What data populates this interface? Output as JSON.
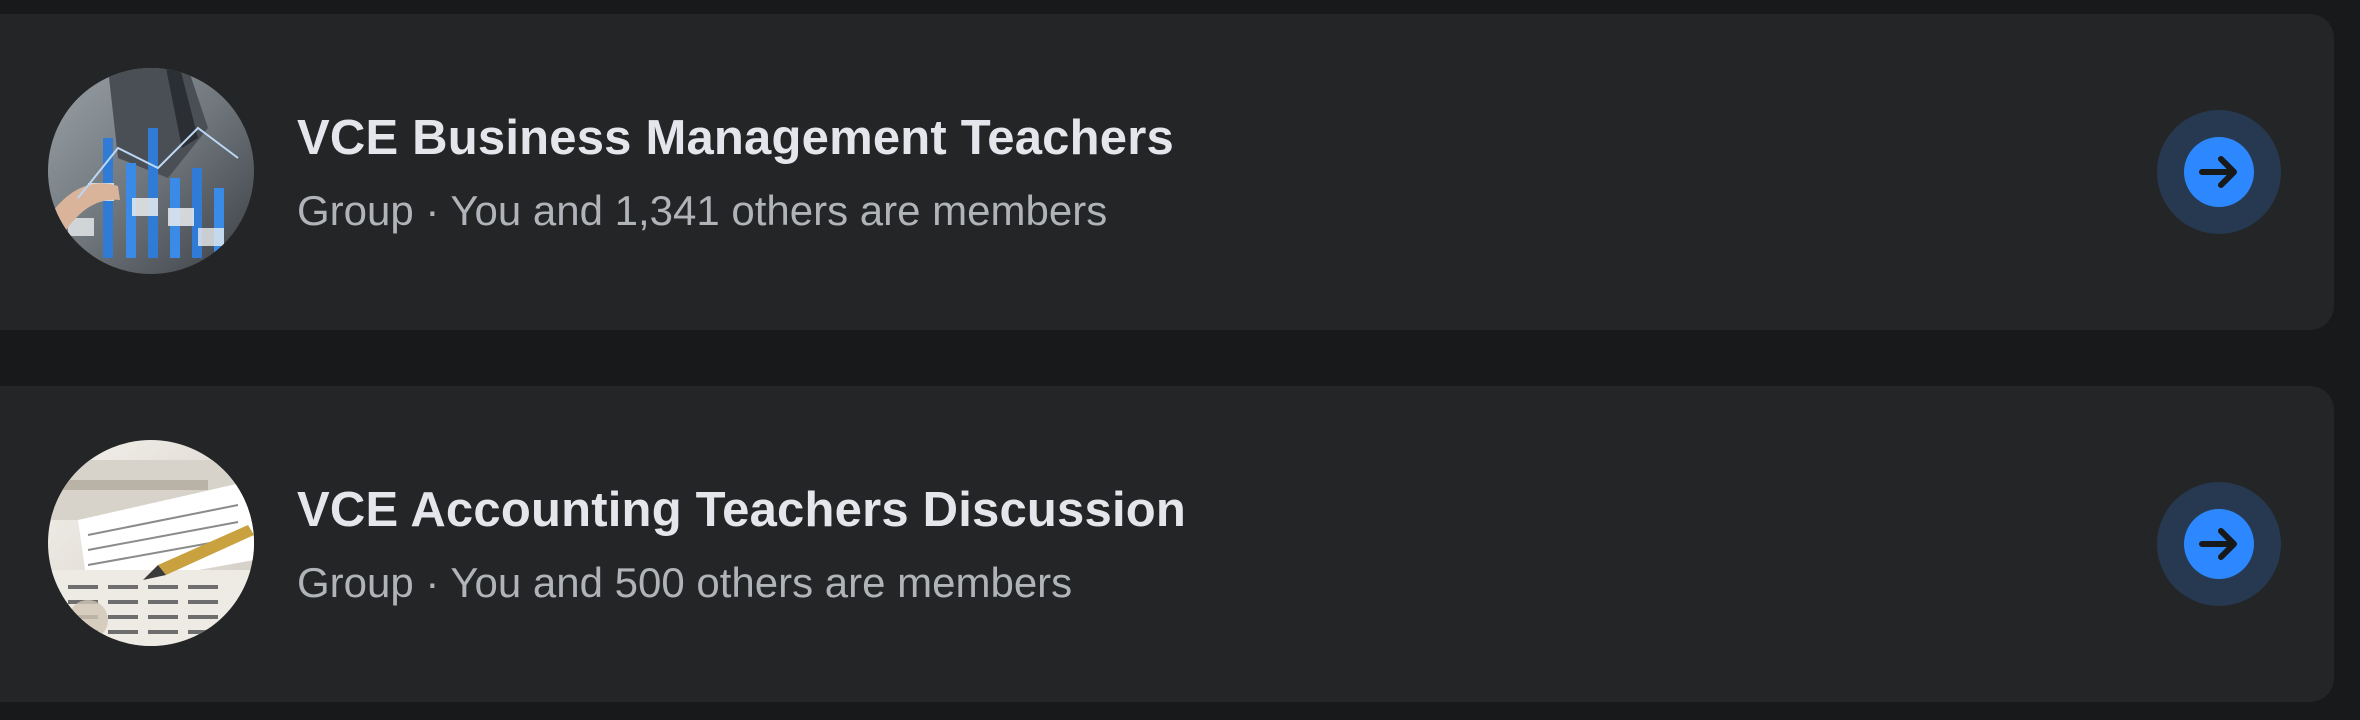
{
  "groups": [
    {
      "name": "VCE Business Management Teachers",
      "type": "Group",
      "members": "You and 1,341 others are members",
      "separator": "·"
    },
    {
      "name": "VCE Accounting Teachers Discussion",
      "type": "Group",
      "members": "You and 500 others are members",
      "separator": "·"
    }
  ],
  "colors": {
    "background": "#18191a",
    "card": "#242526",
    "title": "#e4e6eb",
    "meta": "#b0b3b8",
    "accent": "#2d88ff",
    "button_bg": "#263951"
  },
  "icons": {
    "go_button": "arrow-right-icon"
  }
}
